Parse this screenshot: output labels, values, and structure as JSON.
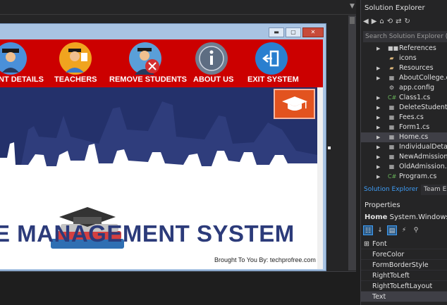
{
  "designer": {
    "nav": [
      {
        "label": "NT DETAILS",
        "icon": "student-icon",
        "bg": "#4a90d9"
      },
      {
        "label": "TEACHERS",
        "icon": "teacher-icon",
        "bg": "#f0a41f"
      },
      {
        "label": "REMOVE STUDENTS",
        "icon": "remove-student-icon",
        "bg": "#5a9fd8"
      },
      {
        "label": "ABOUT US",
        "icon": "info-icon",
        "bg": "#6f7e91"
      },
      {
        "label": "EXIT SYSTEM",
        "icon": "exit-icon",
        "bg": "#2a7fcf"
      }
    ],
    "banner_title": "E MANAGEMENT SYSTEM",
    "footer_credit": "Brought To You By: techprofree.com"
  },
  "solution_explorer": {
    "title": "Solution Explorer",
    "search_placeholder": "Search Solution Explorer (Ctrl+;)",
    "items": [
      {
        "label": "References",
        "icon": "references-icon",
        "expander": true
      },
      {
        "label": "icons",
        "icon": "folder-icon",
        "expander": false
      },
      {
        "label": "Resources",
        "icon": "folder-icon",
        "expander": true
      },
      {
        "label": "AboutCollege.cs",
        "icon": "form-icon",
        "expander": true
      },
      {
        "label": "app.config",
        "icon": "config-icon",
        "expander": false
      },
      {
        "label": "Class1.cs",
        "icon": "csharp-icon",
        "expander": true
      },
      {
        "label": "DeleteStudent.cs",
        "icon": "form-icon",
        "expander": true
      },
      {
        "label": "Fees.cs",
        "icon": "form-icon",
        "expander": true
      },
      {
        "label": "Form1.cs",
        "icon": "form-icon",
        "expander": true
      },
      {
        "label": "Home.cs",
        "icon": "form-icon",
        "expander": true,
        "selected": true
      },
      {
        "label": "IndividualDetails.cs",
        "icon": "form-icon",
        "expander": true
      },
      {
        "label": "NewAdmission.cs",
        "icon": "form-icon",
        "expander": true
      },
      {
        "label": "OldAdmission.cs",
        "icon": "form-icon",
        "expander": true
      },
      {
        "label": "Program.cs",
        "icon": "csharp-icon",
        "expander": true
      }
    ],
    "tabs": [
      "Solution Explorer",
      "Team Explorer"
    ]
  },
  "properties": {
    "title": "Properties",
    "object_name": "Home",
    "object_type": "System.Windows.Forms.Form",
    "rows": [
      {
        "name": "Font",
        "expandable": true
      },
      {
        "name": "ForeColor",
        "expandable": false
      },
      {
        "name": "FormBorderStyle",
        "expandable": false
      },
      {
        "name": "RightToLeft",
        "expandable": false
      },
      {
        "name": "RightToLeftLayout",
        "expandable": false
      },
      {
        "name": "Text",
        "expandable": false,
        "selected": true
      }
    ]
  },
  "colors": {
    "accent": "#3e9cf5",
    "nav_red": "#cc0000",
    "banner_navy": "#24316b",
    "cap_orange": "#e2531f"
  }
}
